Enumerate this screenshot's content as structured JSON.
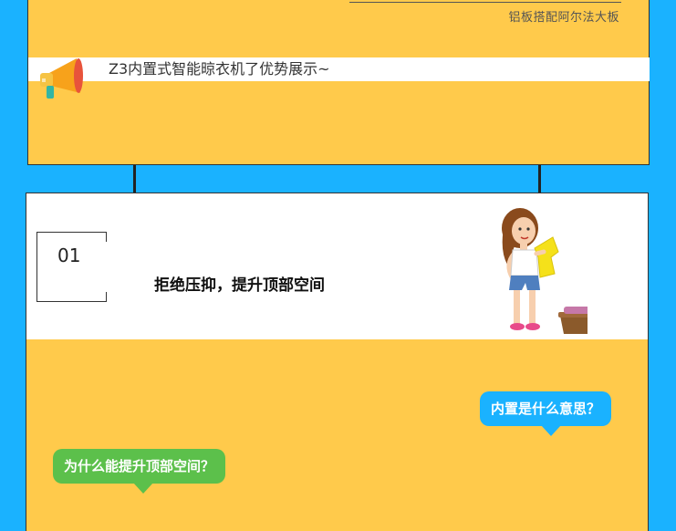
{
  "top_section": {
    "caption": "铝板搭配阿尔法大板",
    "banner_text": "Z3内置式智能晾衣机了优势展示~",
    "icon": "megaphone-icon"
  },
  "feature_card": {
    "number": "01",
    "title": "拒绝压抑，提升顶部空间",
    "illustration": "girl-with-laundry-illustration"
  },
  "speech_bubbles": {
    "question_1": "内置是什么意思？",
    "question_2": "为什么能提升顶部空间？"
  },
  "colors": {
    "background": "#1ab2ff",
    "panel": "#ffca4b",
    "bubble_blue": "#1ab2ff",
    "bubble_green": "#5cc04b"
  }
}
